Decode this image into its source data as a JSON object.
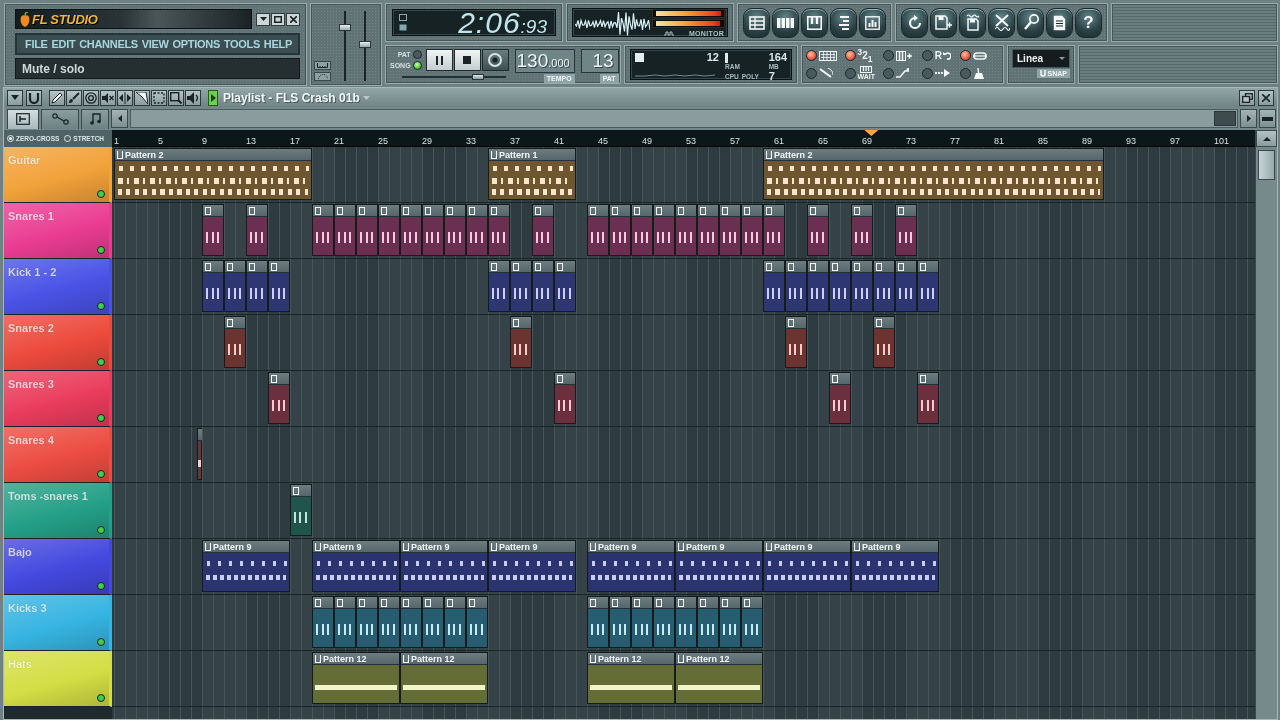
{
  "logo": "FL STUDIO",
  "menu": [
    "FILE",
    "EDIT",
    "CHANNELS",
    "VIEW",
    "OPTIONS",
    "TOOLS",
    "HELP"
  ],
  "hint": "Mute / solo",
  "sliders": [
    {
      "level": 0.8
    },
    {
      "level": 0.52
    }
  ],
  "time": {
    "main": "2:06",
    "fraction": ":93"
  },
  "monitor": {
    "label": "MONITOR",
    "meters": [
      {
        "level": 1
      },
      {
        "level": 0.98
      }
    ]
  },
  "help_label": "?",
  "transport": {
    "modes": [
      {
        "label": "PAT",
        "selected": false
      },
      {
        "label": "SONG",
        "selected": true
      }
    ],
    "position": {
      "level": 0.765
    }
  },
  "tempo": {
    "value": "130",
    "decimals": ".000",
    "label": "TEMPO"
  },
  "pattern": {
    "value": "13",
    "label": "PAT"
  },
  "resources": {
    "graph_value": "12",
    "ram": "164",
    "ram_label": "RAM",
    "ram_unit": "MB",
    "cpu_label": "CPU",
    "poly_label": "POLY",
    "poly": "7"
  },
  "toggles": [
    {
      "kind": "keyboard",
      "on": true
    },
    {
      "kind": "countdown",
      "label": "$^{3}$2$_{1}$",
      "on": true
    },
    {
      "kind": "steps-plus",
      "on": false
    },
    {
      "kind": "record-loop",
      "label": "R",
      "on": false
    },
    {
      "kind": "loop",
      "on": true
    },
    {
      "kind": "wand",
      "on": false
    },
    {
      "kind": "piano",
      "label": "WAIT",
      "on": false
    },
    {
      "kind": "ramp",
      "on": false
    },
    {
      "kind": "arrow",
      "on": false
    },
    {
      "kind": "metronome",
      "on": false
    }
  ],
  "snap": {
    "value": "Linea",
    "label": "SNAP"
  },
  "playlist": {
    "title": "Playlist - FLS Crash 01b",
    "tabs": [
      {
        "selected": true
      },
      {
        "selected": false
      },
      {
        "selected": false
      }
    ],
    "options": [
      {
        "label": "ZERO-CROSS",
        "on": true
      },
      {
        "label": "STRETCH",
        "on": false
      }
    ],
    "ruler": [
      "1",
      "5",
      "9",
      "13",
      "17",
      "21",
      "25",
      "29",
      "33",
      "37",
      "41",
      "45",
      "49",
      "53",
      "57",
      "61",
      "65",
      "69",
      "73",
      "77",
      "81",
      "85",
      "89",
      "93",
      "97",
      "101"
    ],
    "tracks": [
      {
        "name": "Guitar",
        "color": "#f2a23a",
        "active": true,
        "clips": [
          "Pattern 2",
          "Pattern 1",
          "Pattern 2"
        ]
      },
      {
        "name": "Snares 1",
        "color": "#ea3c92",
        "active": true
      },
      {
        "name": "Kick 1 - 2",
        "color": "#4a52e6",
        "active": true
      },
      {
        "name": "Snares 2",
        "color": "#ec4a3c",
        "active": true
      },
      {
        "name": "Snares 3",
        "color": "#ea3c5c",
        "active": true
      },
      {
        "name": "Snares 4",
        "color": "#ec4c42",
        "active": true
      },
      {
        "name": "Toms -snares 1",
        "color": "#24a088",
        "active": true
      },
      {
        "name": "Bajo",
        "color": "#4448de",
        "active": true,
        "clips": [
          "Pattern 9",
          "Pattern 9",
          "Pattern 9",
          "Pattern 9",
          "Pattern 9",
          "Pattern 9",
          "Pattern 9",
          "Pattern 9"
        ]
      },
      {
        "name": "Kicks 3",
        "color": "#36b4e2",
        "active": true
      },
      {
        "name": "Hats",
        "color": "#d4de44",
        "active": true,
        "clips": [
          "Pattern 12",
          "Pattern 12",
          "Pattern 12",
          "Pattern 12"
        ]
      }
    ]
  }
}
